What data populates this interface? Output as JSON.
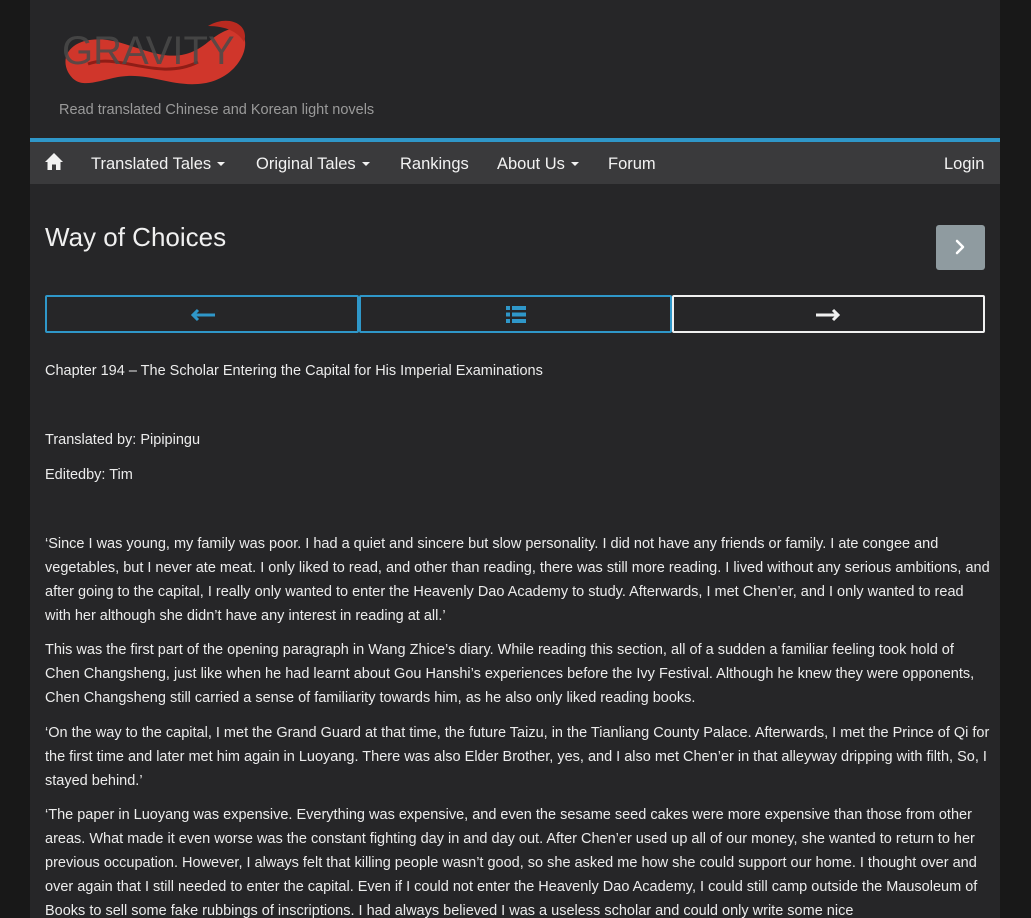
{
  "site": {
    "logo_text": "GRAVITY",
    "tagline": "Read translated Chinese and Korean light novels",
    "accent_color": "#2f97c9",
    "logo_color": "#d9372b"
  },
  "nav": {
    "home_icon": "home-icon",
    "items": [
      {
        "label": "Translated Tales",
        "dropdown": true
      },
      {
        "label": "Original Tales",
        "dropdown": true
      },
      {
        "label": "Rankings",
        "dropdown": false
      },
      {
        "label": "About Us",
        "dropdown": true
      },
      {
        "label": "Forum",
        "dropdown": false
      }
    ],
    "login": "Login"
  },
  "novel": {
    "title": "Way of Choices",
    "next_icon": "chevron-right-icon"
  },
  "chapter_nav": {
    "prev_icon": "arrow-left-icon",
    "toc_icon": "list-icon",
    "next_icon": "arrow-right-icon"
  },
  "chapter": {
    "title": "Chapter 194 – The Scholar Entering the Capital for His Imperial Examinations",
    "translator": "Translated by: Pipipingu",
    "editor": "Editedby: Tim",
    "paragraphs": [
      "‘Since I was young, my family was poor. I had a quiet and sincere but slow personality. I did not have any friends or family. I ate congee and vegetables, but I never ate meat. I only liked to read, and other than reading, there was still more reading. I lived without any serious ambitions, and after going to the capital, I really only wanted to enter the Heavenly Dao Academy to study. Afterwards, I met Chen’er, and I only wanted to read with her although she didn’t have any interest in reading at all.’",
      "This was the first part of the opening paragraph in Wang Zhice’s diary. While reading this section, all of a sudden a familiar feeling took hold of Chen Changsheng, just like when he had learnt about Gou Hanshi’s experiences before the Ivy Festival. Although he knew they were opponents, Chen Changsheng still carried a sense of familiarity towards him, as he also only liked reading books.",
      "‘On the way to the capital, I met the Grand Guard at that time, the future Taizu, in the Tianliang County Palace. Afterwards, I met the Prince of Qi for the first time and later met him again in Luoyang. There was also Elder Brother, yes, and I also met Chen’er in that alleyway dripping with filth, So, I stayed behind.’",
      "‘The paper in Luoyang was expensive. Everything was expensive, and even the sesame seed cakes were more expensive than those from other areas. What made it even worse was the constant fighting day in and day out. After Chen’er used up all of our money, she wanted to return to her previous occupation. However, I always felt that killing people wasn’t good, so she asked me how she could support our home. I thought over and over again that I still needed to enter the capital. Even if I could not enter the Heavenly Dao Academy, I could still camp outside the Mausoleum of Books to sell some fake rubbings of inscriptions. I had always believed I was a useless scholar and could only write some nice"
    ]
  }
}
